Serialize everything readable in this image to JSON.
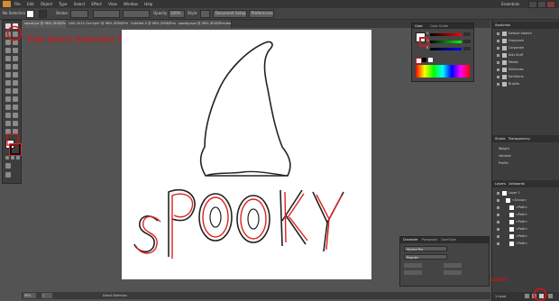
{
  "menu": {
    "items": [
      "File",
      "Edit",
      "Object",
      "Type",
      "Select",
      "Effect",
      "View",
      "Window",
      "Help"
    ],
    "workspace": "Essentials"
  },
  "control": {
    "selection_label": "No Selection",
    "stroke_label": "Stroke:",
    "style_label": "Style:",
    "opacity_label": "Opacity",
    "opacity_value": "100%",
    "doc_setup": "Document Setup",
    "preferences": "Preferences"
  },
  "tabs": [
    {
      "label": "spooky.ai @ 98% (RGB/Preview)"
    },
    {
      "label": "UAE-2012-Oct.eps* @ 98% (RGB/Preview)"
    },
    {
      "label": "Untitled-3 @ 98% (RGB/Preview)"
    },
    {
      "label": "spooky.eps @ 98% (RGB/Preview)"
    }
  ],
  "artwork": {
    "word": "SPOOKY"
  },
  "color_panel": {
    "title": "Color",
    "guide_tab": "Color Guide",
    "channels": [
      "R",
      "G",
      "B"
    ],
    "values": [
      "",
      "",
      ""
    ]
  },
  "swatches": {
    "title": "Swatches",
    "items": [
      "Default Swatch",
      "Grayscale",
      "Corporate",
      "Kids Stuff",
      "Metals",
      "Skintones",
      "Earthtone",
      "Brights"
    ]
  },
  "stroke_panel": {
    "tabs": [
      "Stroke",
      "Transparency"
    ],
    "labels": [
      "Weight",
      "Variable",
      "Profile"
    ]
  },
  "layers": {
    "title": "Layers",
    "tab2": "Artboards",
    "items": [
      "Layer 1",
      "<Group>",
      "<Path>",
      "<Path>",
      "<Path>",
      "<Path>",
      "<Path>",
      "<Path>"
    ],
    "footer": "1 Layer"
  },
  "character_panel": {
    "tabs": [
      "Character",
      "Paragraph",
      "OpenType"
    ],
    "font": "Myriad Pro",
    "style": "Regular"
  },
  "status": {
    "zoom": "98%",
    "page": "1",
    "tool": "Direct Selection"
  },
  "annotations": {
    "direct_select": "Pick Direct Selection Tool to separate layers",
    "new_layer": "Add new layer for colors"
  },
  "colors": {
    "annotation": "#e01010",
    "artwork_stroke": "#222222",
    "artwork_red": "#e02020"
  }
}
